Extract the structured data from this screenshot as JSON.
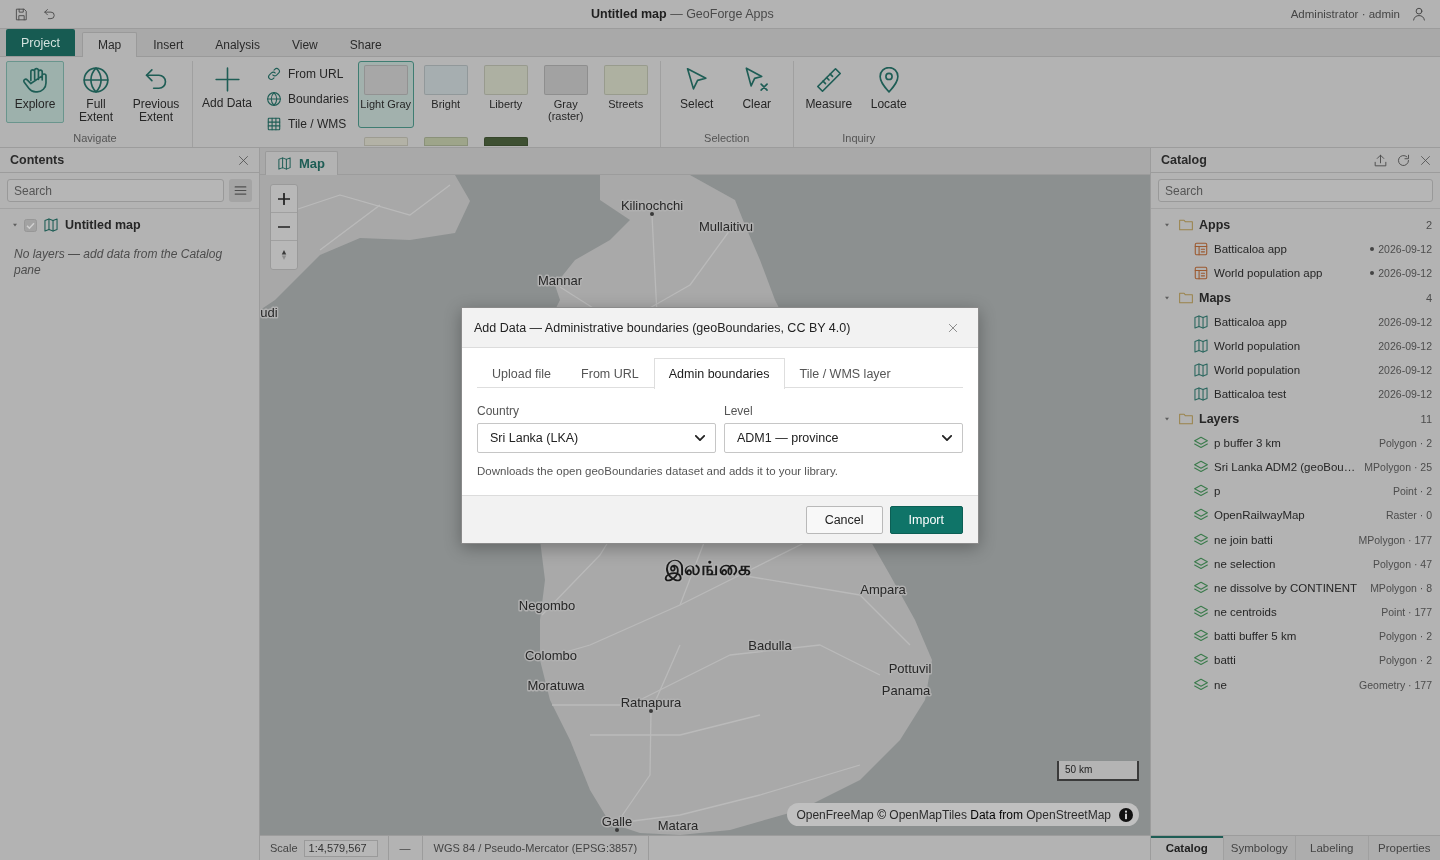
{
  "title_bar": {
    "title": "**Untitled map** — GeoForge Apps",
    "user": "Administrator · admin"
  },
  "ribbon": {
    "tabs": [
      {
        "label": "Project",
        "kind": "backstage",
        "selected": false
      },
      {
        "label": "Map",
        "kind": "tab",
        "selected": true
      },
      {
        "label": "Insert",
        "kind": "tab",
        "selected": false
      },
      {
        "label": "Analysis",
        "kind": "tab",
        "selected": false
      },
      {
        "label": "View",
        "kind": "tab",
        "selected": false
      },
      {
        "label": "Share",
        "kind": "tab",
        "selected": false
      }
    ],
    "groups": [
      {
        "kind": "tools",
        "label": "Navigate",
        "buttons": [
          {
            "label": "Explore",
            "selected": true
          },
          {
            "label": "Full Extent",
            "selected": false
          },
          {
            "label": "Previous Extent",
            "selected": false
          }
        ]
      },
      {
        "kind": "add-data",
        "button": "Add Data",
        "links": [
          "From URL",
          "Boundaries",
          "Tile / WMS"
        ],
        "basemaps": [
          {
            "label": "Light Gray",
            "selected": true,
            "color": "#a7a7a7"
          },
          {
            "label": "Bright",
            "selected": false,
            "color": "#a6aeb0"
          },
          {
            "label": "Liberty",
            "selected": false,
            "color": "#adb0a2"
          },
          {
            "label": "Gray (raster)",
            "selected": false,
            "color": "#a2a2a2"
          },
          {
            "label": "Streets",
            "selected": false,
            "color": "#aeb1a1"
          },
          {
            "selected": false,
            "color": "#b3b2a6"
          },
          {
            "selected": false,
            "color": "#9ea58a"
          },
          {
            "selected": false,
            "color": "#3e5032"
          }
        ]
      },
      {
        "kind": "tools",
        "label": "Selection",
        "buttons": [
          {
            "label": "Select",
            "selected": false
          },
          {
            "label": "Clear",
            "selected": false
          }
        ]
      },
      {
        "kind": "tools",
        "label": "Inquiry",
        "buttons": [
          {
            "label": "Measure",
            "selected": false
          },
          {
            "label": "Locate",
            "selected": false
          }
        ]
      }
    ]
  },
  "contents": {
    "title": "Contents",
    "search": {
      "placeholder": "Search"
    },
    "tree": [
      {
        "label": "Untitled map",
        "expanded": true,
        "checked": true
      }
    ],
    "empty_message": "No layers — add data from the Catalog pane"
  },
  "map": {
    "tabs": [
      {
        "label": "Map",
        "selected": true
      }
    ],
    "places": [
      {
        "name": "Kilinochchi",
        "kind": "city",
        "dot": true
      },
      {
        "name": "Mullaitivu",
        "kind": "city",
        "dot": false
      },
      {
        "name": "Mannar",
        "kind": "city",
        "dot": false
      },
      {
        "name": "udi",
        "kind": "city",
        "dot": false
      },
      {
        "name": "இலங்கை",
        "kind": "country",
        "dot": false
      },
      {
        "name": "Ampara",
        "kind": "city",
        "dot": false
      },
      {
        "name": "Negombo",
        "kind": "city",
        "dot": false
      },
      {
        "name": "Badulla",
        "kind": "city",
        "dot": false
      },
      {
        "name": "Colombo",
        "kind": "city",
        "dot": false
      },
      {
        "name": "Pottuvil",
        "kind": "city",
        "dot": false
      },
      {
        "name": "Moratuwa",
        "kind": "city",
        "dot": false
      },
      {
        "name": "Panama",
        "kind": "city",
        "dot": false
      },
      {
        "name": "Ratnapura",
        "kind": "city",
        "dot": true
      },
      {
        "name": "Galle",
        "kind": "city",
        "dot": true
      },
      {
        "name": "Matara",
        "kind": "city",
        "dot": false
      }
    ],
    "scale_bar": "50 km",
    "attribution": [
      {
        "kind": "link",
        "text": "OpenFreeMap"
      },
      {
        "kind": "text",
        "text": "©"
      },
      {
        "kind": "link",
        "text": "OpenMapTiles"
      },
      {
        "kind": "text",
        "text": "Data from"
      },
      {
        "kind": "link",
        "text": "OpenStreetMap"
      }
    ]
  },
  "status_bar": {
    "scale_label": "Scale",
    "scale": "1:4,579,567",
    "items": [
      "—",
      "WGS 84 / Pseudo-Mercator (EPSG:3857)"
    ]
  },
  "catalog": {
    "title": "Catalog",
    "search": {
      "placeholder": "Search"
    },
    "folders": [
      {
        "label": "Apps",
        "count": "2",
        "expanded": true,
        "children": [
          {
            "kind": "app",
            "label": "Batticaloa app",
            "meta": "2026-09-12",
            "marked": true
          },
          {
            "kind": "app",
            "label": "World population app",
            "meta": "2026-09-12",
            "marked": true
          }
        ]
      },
      {
        "label": "Maps",
        "count": "4",
        "expanded": true,
        "children": [
          {
            "kind": "map",
            "label": "Batticaloa app",
            "meta": "2026-09-12",
            "marked": false
          },
          {
            "kind": "map",
            "label": "World population",
            "meta": "2026-09-12",
            "marked": false
          },
          {
            "kind": "map",
            "label": "World population",
            "meta": "2026-09-12",
            "marked": false
          },
          {
            "kind": "map",
            "label": "Batticaloa test",
            "meta": "2026-09-12",
            "marked": false
          }
        ]
      },
      {
        "label": "Layers",
        "count": "11",
        "expanded": true,
        "children": [
          {
            "kind": "layer",
            "label": "p buffer 3 km",
            "meta": "Polygon · 2",
            "marked": false
          },
          {
            "kind": "layer",
            "label": "Sri Lanka ADM2 (geoBou…",
            "meta": "MPolygon · 25",
            "marked": false
          },
          {
            "kind": "layer",
            "label": "p",
            "meta": "Point · 2",
            "marked": false
          },
          {
            "kind": "layer",
            "label": "OpenRailwayMap",
            "meta": "Raster · 0",
            "marked": false
          },
          {
            "kind": "layer",
            "label": "ne join batti",
            "meta": "MPolygon · 177",
            "marked": false
          },
          {
            "kind": "layer",
            "label": "ne selection",
            "meta": "Polygon · 47",
            "marked": false
          },
          {
            "kind": "layer",
            "label": "ne dissolve by CONTINENT",
            "meta": "MPolygon · 8",
            "marked": false
          },
          {
            "kind": "layer",
            "label": "ne centroids",
            "meta": "Point · 177",
            "marked": false
          },
          {
            "kind": "layer",
            "label": "batti buffer 5 km",
            "meta": "Polygon · 2",
            "marked": false
          },
          {
            "kind": "layer",
            "label": "batti",
            "meta": "Polygon · 2",
            "marked": false
          },
          {
            "kind": "layer",
            "label": "ne",
            "meta": "Geometry · 177",
            "marked": false
          }
        ]
      }
    ]
  },
  "panel_tabs": [
    {
      "label": "Catalog",
      "selected": true
    },
    {
      "label": "Symbology",
      "selected": false
    },
    {
      "label": "Labeling",
      "selected": false
    },
    {
      "label": "Properties",
      "selected": false
    }
  ],
  "dialog": {
    "title": "Add Data — Administrative boundaries (geoBoundaries, CC BY 4.0)",
    "tabs": [
      {
        "label": "Upload file",
        "selected": false
      },
      {
        "label": "From URL",
        "selected": false
      },
      {
        "label": "Admin boundaries",
        "selected": true
      },
      {
        "label": "Tile / WMS layer",
        "selected": false
      }
    ],
    "fields": [
      {
        "label": "Country",
        "value": "Sri Lanka (LKA)"
      },
      {
        "label": "Level",
        "value": "ADM1 — province"
      }
    ],
    "hint": "Downloads the open geoBoundaries dataset and adds it to your library.",
    "buttons": [
      {
        "label": "Cancel",
        "kind": "secondary"
      },
      {
        "label": "Import",
        "kind": "primary"
      }
    ]
  }
}
